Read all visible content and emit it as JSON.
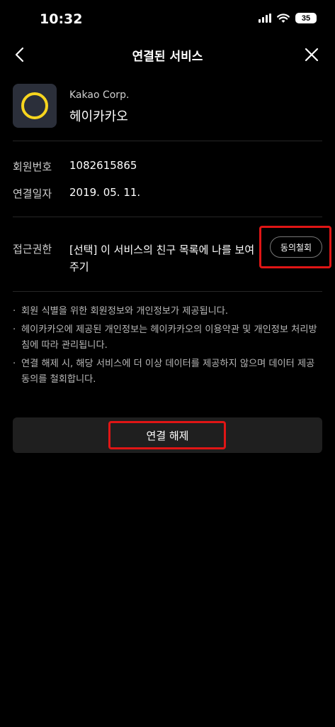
{
  "status_bar": {
    "time": "10:32",
    "battery": "35"
  },
  "nav": {
    "title": "연결된 서비스"
  },
  "app": {
    "company": "Kakao Corp.",
    "name": "헤이카카오"
  },
  "info": [
    {
      "label": "회원번호",
      "value": "1082615865"
    },
    {
      "label": "연결일자",
      "value": "2019. 05. 11."
    }
  ],
  "permission": {
    "label": "접근권한",
    "text": "[선택] 이 서비스의 친구 목록에 나를 보여주기",
    "button": "동의철회"
  },
  "notes": [
    "회원 식별을 위한 회원정보와 개인정보가 제공됩니다.",
    "헤이카카오에 제공된 개인정보는 헤이카카오의 이용약관 및 개인정보 처리방침에 따라 관리됩니다.",
    "연결 해제 시, 해당 서비스에 더 이상 데이터를 제공하지 않으며 데이터 제공 동의를 철회합니다."
  ],
  "disconnect_button": "연결 해제",
  "colors": {
    "background": "#000000",
    "highlight": "#e01515",
    "logo_ring": "#f7d51e",
    "button_bg": "#1f1f1f"
  }
}
